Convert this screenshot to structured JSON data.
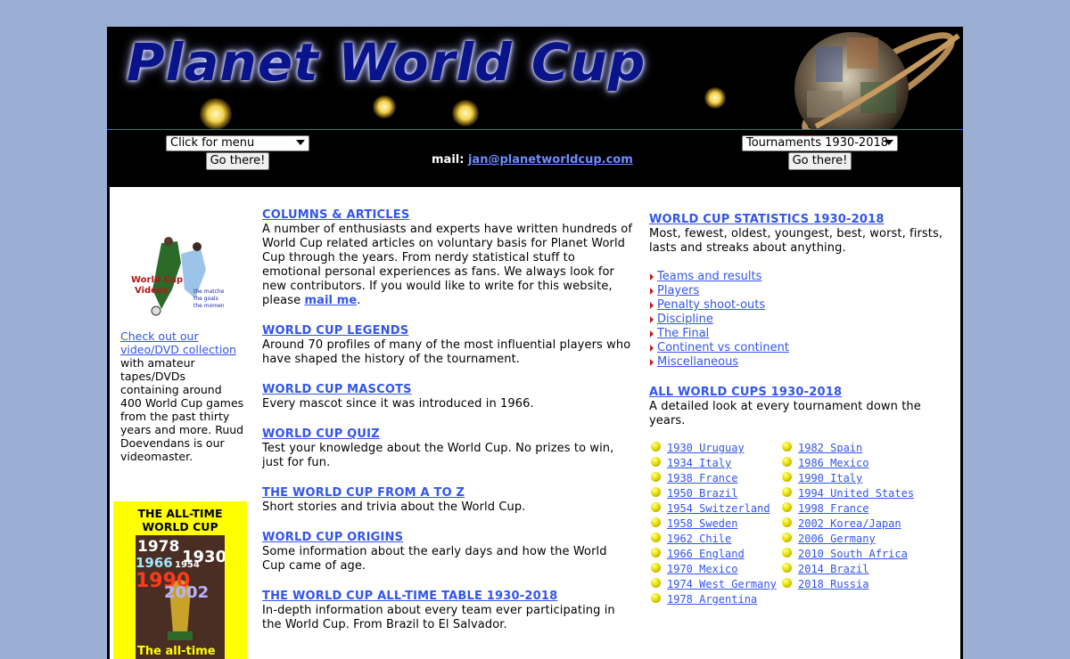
{
  "banner": {
    "title": "Planet World Cup"
  },
  "nav": {
    "menu_select": "Click for menu",
    "go_left": "Go there!",
    "mail_label": "mail:",
    "mail_address": "jan@planetworldcup.com",
    "tournament_select": "Tournaments 1930-2018",
    "go_right": "Go there!"
  },
  "left": {
    "dvd_image_text": "World Cup Videos",
    "dvd_image_tagline": "the matches the goals the moments",
    "dvd_link": "Check out our video/DVD collection",
    "dvd_text": "with amateur tapes/DVDs containing around 400 World Cup games from the past thirty years and more. Ruud Doevendans is our videomaster.",
    "alltime_title_1": "THE ALL-TIME",
    "alltime_title_2": "WORLD CUP",
    "cover": {
      "y1978": "1978",
      "y1930": "1930",
      "y1966": "1966",
      "y1954": "1954",
      "y1990": "1990",
      "y2002": "2002",
      "bottom": "The all-time"
    }
  },
  "middle": {
    "sections": [
      {
        "title": "COLUMNS & ARTICLES",
        "text_before": "A number of enthusiasts and experts have written hundreds of World Cup related articles on voluntary basis for Planet World Cup through the years. From nerdy statistical stuff to emotional personal experiences as fans. We always look for new contributors. If you would like to write for this website, please ",
        "link": "mail me",
        "text_after": "."
      },
      {
        "title": "WORLD CUP LEGENDS",
        "text": "Around 70 profiles of many of the most influential players who have shaped the history of the tournament."
      },
      {
        "title": "WORLD CUP MASCOTS",
        "text": "Every mascot since it was introduced in 1966."
      },
      {
        "title": "WORLD CUP QUIZ",
        "text": "Test your knowledge about the World Cup. No prizes to win, just for fun."
      },
      {
        "title": "THE WORLD CUP FROM A TO Z",
        "text": "Short stories and trivia about the World Cup."
      },
      {
        "title": "WORLD CUP ORIGINS",
        "text": "Some information about the early days and how the World Cup came of age."
      },
      {
        "title": "THE WORLD CUP ALL-TIME TABLE 1930-2018",
        "text": "In-depth information about every team ever participating in the World Cup. From Brazil to El Salvador."
      }
    ]
  },
  "right": {
    "stats_title": "WORLD CUP STATISTICS 1930-2018",
    "stats_text": "Most, fewest, oldest, youngest, best, worst, firsts, lasts and streaks about anything.",
    "stats_links": [
      "Teams and results",
      "Players",
      "Penalty shoot-outs",
      "Discipline",
      "The Final",
      "Continent vs continent",
      "Miscellaneous"
    ],
    "cups_title": "ALL WORLD CUPS 1930-2018",
    "cups_text": "A detailed look at every tournament down the years.",
    "cups_col1": [
      "1930 Uruguay",
      "1934 Italy",
      "1938 France",
      "1950 Brazil",
      "1954 Switzerland",
      "1958 Sweden",
      "1962 Chile",
      "1966 England",
      "1970 Mexico",
      "1974 West Germany",
      "1978 Argentina"
    ],
    "cups_col2": [
      "1982 Spain",
      "1986 Mexico",
      "1990 Italy",
      "1994 United States",
      "1998 France",
      "2002 Korea/Japan",
      "2006 Germany",
      "2010 South Africa",
      "2014 Brazil",
      "2018 Russia"
    ]
  }
}
